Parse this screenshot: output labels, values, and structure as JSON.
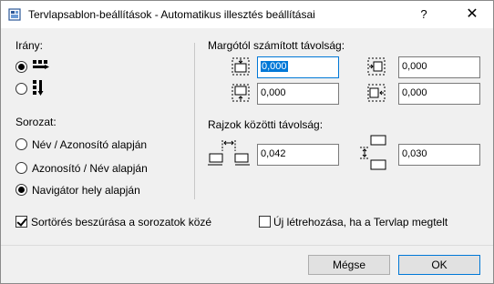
{
  "window": {
    "title": "Tervlapsablon-beállítások - Automatikus illesztés beállításai",
    "help_label": "?",
    "close_label": "✕"
  },
  "direction": {
    "label": "Irány:"
  },
  "series": {
    "label": "Sorozat:",
    "options": [
      {
        "label": "Név / Azonosító alapján",
        "checked": false
      },
      {
        "label": "Azonosító / Név alapján",
        "checked": false
      },
      {
        "label": "Navigátor hely alapján",
        "checked": true
      }
    ]
  },
  "margin": {
    "label": "Margótól számított távolság:",
    "top_value": "0,000",
    "right_value": "0,000",
    "bottom_value": "0,000",
    "left_value": "0,000"
  },
  "spacing": {
    "label": "Rajzok közötti távolság:",
    "horizontal_value": "0,042",
    "vertical_value": "0,030"
  },
  "options": {
    "insert_breaks_label": "Sortörés beszúrása a sorozatok közé",
    "insert_breaks_checked": true,
    "create_new_label": "Új létrehozása, ha a Tervlap megtelt",
    "create_new_checked": false
  },
  "buttons": {
    "cancel_label": "Mégse",
    "ok_label": "OK"
  }
}
